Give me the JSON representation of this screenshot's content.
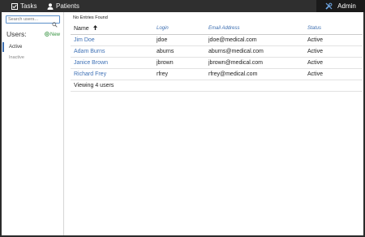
{
  "nav": {
    "tasks_label": "Tasks",
    "patients_label": "Patients",
    "admin_label": "Admin"
  },
  "sidebar": {
    "search_placeholder": "Search users...",
    "users_title": "Users:",
    "new_label": "New",
    "items": [
      {
        "label": "Active"
      },
      {
        "label": "Inactive"
      }
    ]
  },
  "main": {
    "status_message": "No Entries Found",
    "columns": [
      "Name",
      "Login",
      "Email Address",
      "Status"
    ],
    "rows": [
      {
        "name": "Jim Doe",
        "login": "jdoe",
        "email": "jdoe@medical.com",
        "status": "Active"
      },
      {
        "name": "Adam Burns",
        "login": "aburns",
        "email": "aburns@medical.com",
        "status": "Active"
      },
      {
        "name": "Janice Brown",
        "login": "jbrown",
        "email": "jbrown@medical.com",
        "status": "Active"
      },
      {
        "name": "Richard Frey",
        "login": "rfrey",
        "email": "rfrey@medical.com",
        "status": "Active"
      }
    ],
    "footer": "Viewing 4 users"
  },
  "colors": {
    "accent": "#3d70b5",
    "new_green": "#2f8f3a",
    "topbar": "#2f2f2f"
  }
}
